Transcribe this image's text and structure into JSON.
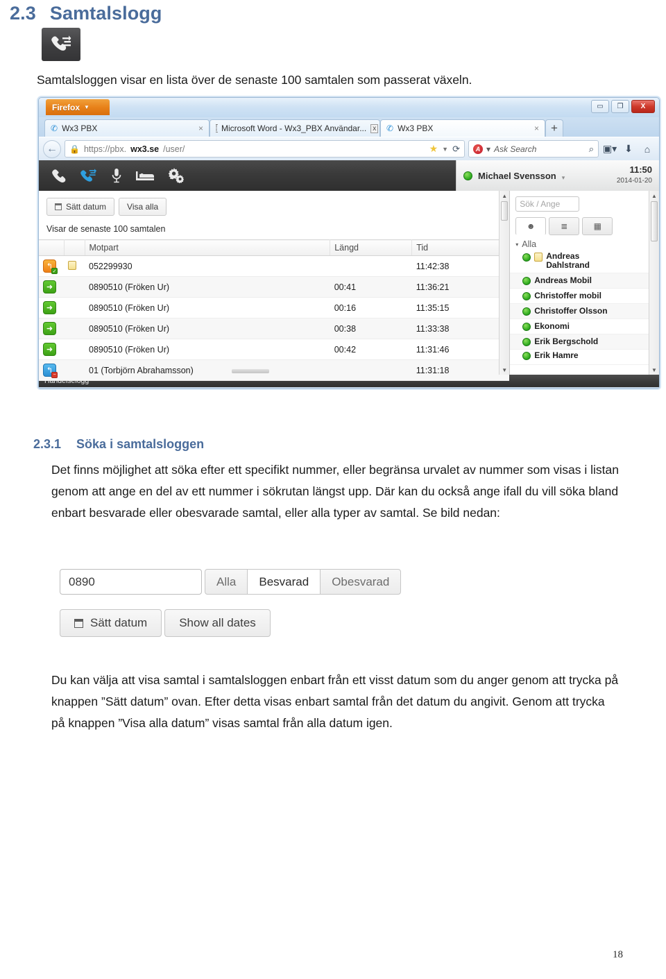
{
  "document": {
    "section_number": "2.3",
    "section_title": "Samtalslogg",
    "app_icon": "call-log-icon",
    "intro_paragraph": "Samtalsloggen visar en lista över de senaste 100 samtalen som passerat växeln.",
    "subsection_number": "2.3.1",
    "subsection_title": "Söka i samtalsloggen",
    "paragraph_1": "Det finns möjlighet att söka efter ett specifikt nummer, eller begränsa urvalet av nummer som visas i listan genom att ange en del av ett nummer i sökrutan längst upp. Där kan du också ange ifall du vill söka bland enbart besvarade eller obesvarade samtal, eller alla typer av samtal. Se bild nedan:",
    "paragraph_2": "Du kan välja att visa samtal i samtalsloggen enbart från ett visst datum som du anger genom att trycka på knappen ”Sätt datum” ovan. Efter detta visas enbart samtal från det datum du angivit. Genom att trycka på knappen ”Visa alla datum” visas samtal från alla datum igen.",
    "page_number": "18",
    "heading_color": "#4a6c9b"
  },
  "browser": {
    "firefox_menu_label": "Firefox",
    "window_buttons": {
      "minimize": "–",
      "maximize": "□",
      "close": "X"
    },
    "tabs": [
      {
        "title": "Wx3 PBX",
        "favicon": "phone-icon",
        "close": "×",
        "active": false
      },
      {
        "title": "Microsoft Word - Wx3_PBX Användar...",
        "favicon": "word-doc-icon",
        "close": "x",
        "active": false
      },
      {
        "title": "Wx3 PBX",
        "favicon": "phone-icon",
        "close": "×",
        "active": true
      }
    ],
    "new_tab_label": "+",
    "back_icon": "back-arrow-icon",
    "url_prefix": "https://pbx.",
    "url_host": "wx3.se",
    "url_suffix": "/user/",
    "lock_icon": "lock-icon",
    "star_icon": "bookmark-star-icon",
    "reload_icon": "reload-icon",
    "search_engine": "Ask",
    "search_placeholder": "Ask Search",
    "search_icon": "magnifier-icon",
    "toolbar_icons": [
      "bookmarks-icon",
      "downloads-icon",
      "home-icon"
    ]
  },
  "pbx": {
    "toolbar_icons": [
      {
        "name": "phone-icon",
        "active": false
      },
      {
        "name": "call-log-icon",
        "active": true
      },
      {
        "name": "microphone-icon",
        "active": false
      },
      {
        "name": "bed-icon",
        "active": false
      },
      {
        "name": "settings-gears-icon",
        "active": false
      }
    ],
    "user": {
      "status": "online",
      "status_color": "#3da115",
      "name": "Michael Svensson",
      "time": "11:50",
      "date": "2014-01-20",
      "caret": "▾"
    },
    "buttons": {
      "set_date": "Sätt datum",
      "show_all": "Visa alla",
      "calendar_icon": "calendar-icon"
    },
    "showing_text": "Visar de senaste 100 samtalen",
    "table": {
      "headers": [
        "",
        "",
        "Motpart",
        "Längd",
        "Tid"
      ],
      "rows": [
        {
          "direction": "in-answered",
          "note": true,
          "motpart": "052299930",
          "langd": "",
          "tid": "11:42:38"
        },
        {
          "direction": "outgoing",
          "note": false,
          "motpart": "0890510 (Fröken Ur)",
          "langd": "00:41",
          "tid": "11:36:21"
        },
        {
          "direction": "outgoing",
          "note": false,
          "motpart": "0890510 (Fröken Ur)",
          "langd": "00:16",
          "tid": "11:35:15"
        },
        {
          "direction": "outgoing",
          "note": false,
          "motpart": "0890510 (Fröken Ur)",
          "langd": "00:38",
          "tid": "11:33:38"
        },
        {
          "direction": "outgoing",
          "note": false,
          "motpart": "0890510 (Fröken Ur)",
          "langd": "00:42",
          "tid": "11:31:46"
        },
        {
          "direction": "in-missed",
          "note": false,
          "motpart": "01 (Torbjörn Abrahamsson)",
          "langd": "",
          "tid": "11:31:18"
        }
      ]
    },
    "contacts_panel": {
      "search_placeholder": "Sök / Ange",
      "tabs": [
        {
          "icon": "person-icon",
          "active": true
        },
        {
          "icon": "list-icon",
          "active": false
        },
        {
          "icon": "address-book-icon",
          "active": false
        }
      ],
      "group_label": "Alla",
      "group_caret": "▾",
      "contacts": [
        {
          "name": "Andreas Dahlstrand",
          "status": "online",
          "note": true
        },
        {
          "name": "Andreas Mobil",
          "status": "online",
          "note": false
        },
        {
          "name": "Christoffer mobil",
          "status": "online",
          "note": false
        },
        {
          "name": "Christoffer Olsson",
          "status": "online",
          "note": false
        },
        {
          "name": "Ekonomi",
          "status": "online",
          "note": false
        },
        {
          "name": "Erik Bergschold",
          "status": "online",
          "note": false
        },
        {
          "name": "Erik Hamre",
          "status": "online",
          "note": false
        }
      ]
    },
    "status_bar": "Händelselogg"
  },
  "search_figure": {
    "input_value": "0890",
    "segments": [
      {
        "label": "Alla",
        "selected": false
      },
      {
        "label": "Besvarad",
        "selected": true
      },
      {
        "label": "Obesvarad",
        "selected": false
      }
    ],
    "set_date_button": "Sätt datum",
    "show_all_dates_button": "Show all dates",
    "calendar_icon": "calendar-icon"
  }
}
